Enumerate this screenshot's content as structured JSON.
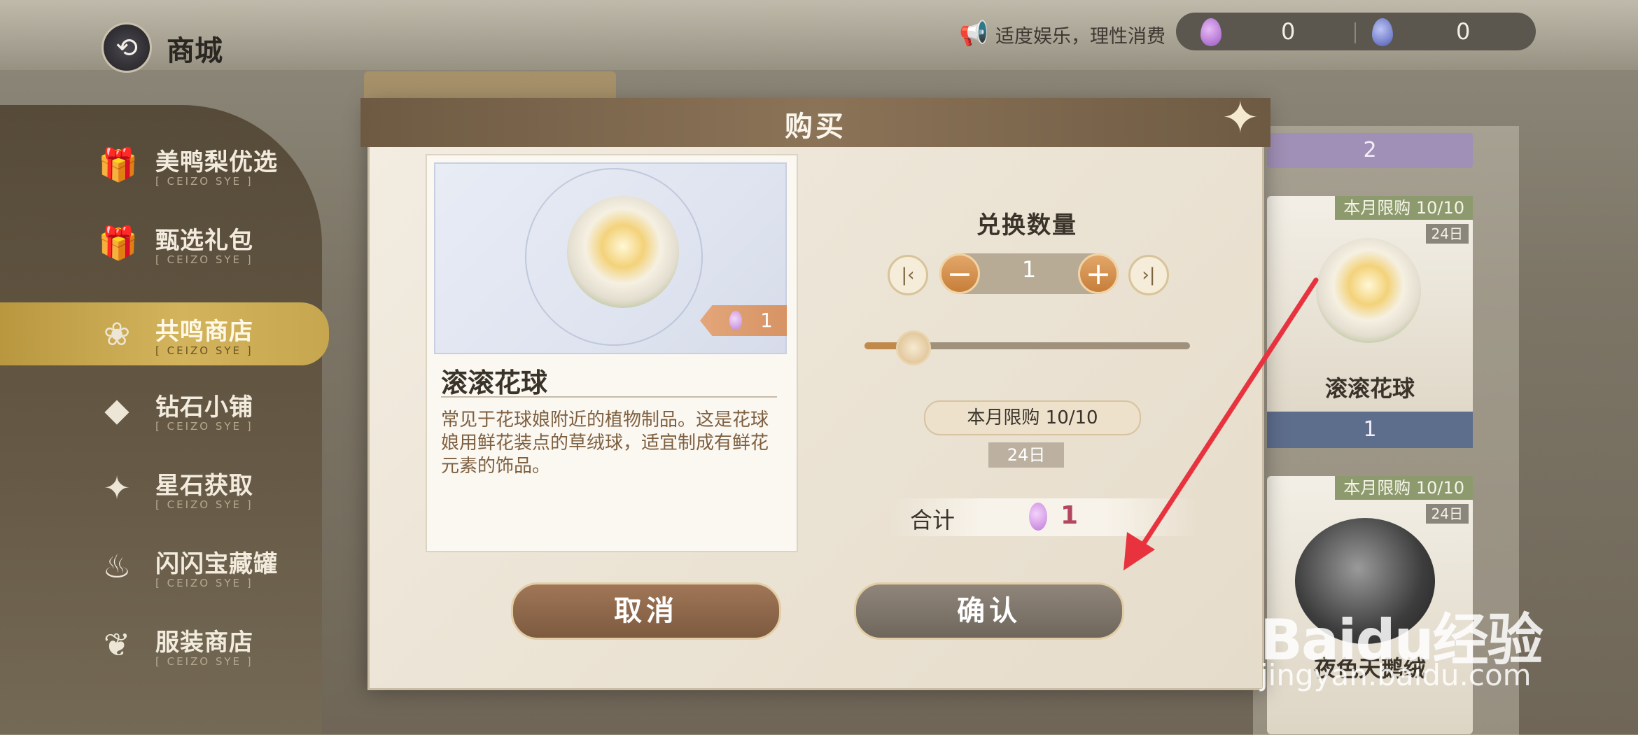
{
  "header": {
    "title": "商城",
    "notice": "适度娱乐，理性消费",
    "currencies": [
      {
        "icon": "purple-gem-icon",
        "value": "0"
      },
      {
        "icon": "blue-gem-icon",
        "value": "0"
      }
    ]
  },
  "sidebar": {
    "items": [
      {
        "label": "美鸭梨优选",
        "sub": "[ CEIZO SYE ]",
        "icon": "gift-box-icon"
      },
      {
        "label": "甄选礼包",
        "sub": "[ CEIZO SYE ]",
        "icon": "gift-box-icon"
      },
      {
        "label": "共鸣商店",
        "sub": "[ CEIZO SYE ]",
        "icon": "swirl-icon",
        "active": true
      },
      {
        "label": "钻石小铺",
        "sub": "[ CEIZO SYE ]",
        "icon": "diamond-icon"
      },
      {
        "label": "星石获取",
        "sub": "[ CEIZO SYE ]",
        "icon": "star-stone-icon"
      },
      {
        "label": "闪闪宝藏罐",
        "sub": "[ CEIZO SYE ]",
        "icon": "treasure-jar-icon"
      },
      {
        "label": "服装商店",
        "sub": "[ CEIZO SYE ]",
        "icon": "clothes-icon"
      }
    ]
  },
  "shop_cards": {
    "top_price": "2",
    "card1": {
      "limit": "本月限购 10/10",
      "days": "24日",
      "name": "滚滚花球",
      "price": "1"
    },
    "card2": {
      "limit": "本月限购 10/10",
      "days": "24日",
      "name": "夜色天鹅绒"
    }
  },
  "dialog": {
    "title": "购买",
    "item": {
      "name": "滚滚花球",
      "price": "1",
      "description": "常见于花球娘附近的植物制品。这是花球娘用鲜花装点的草绒球，适宜制成有鲜花元素的饰品。"
    },
    "quantity_title": "兑换数量",
    "quantity": "1",
    "quantity_fraction": 0.1,
    "limit": "本月限购 10/10",
    "days": "24日",
    "total_label": "合计",
    "total_value": "1",
    "cancel": "取消",
    "confirm": "确认"
  },
  "watermark": {
    "logo": "Baidu经验",
    "url": "jingyan.baidu.com"
  },
  "colors": {
    "accent": "#c77e3a",
    "annotation_arrow": "#e8333f",
    "total_value": "#b3475f"
  }
}
